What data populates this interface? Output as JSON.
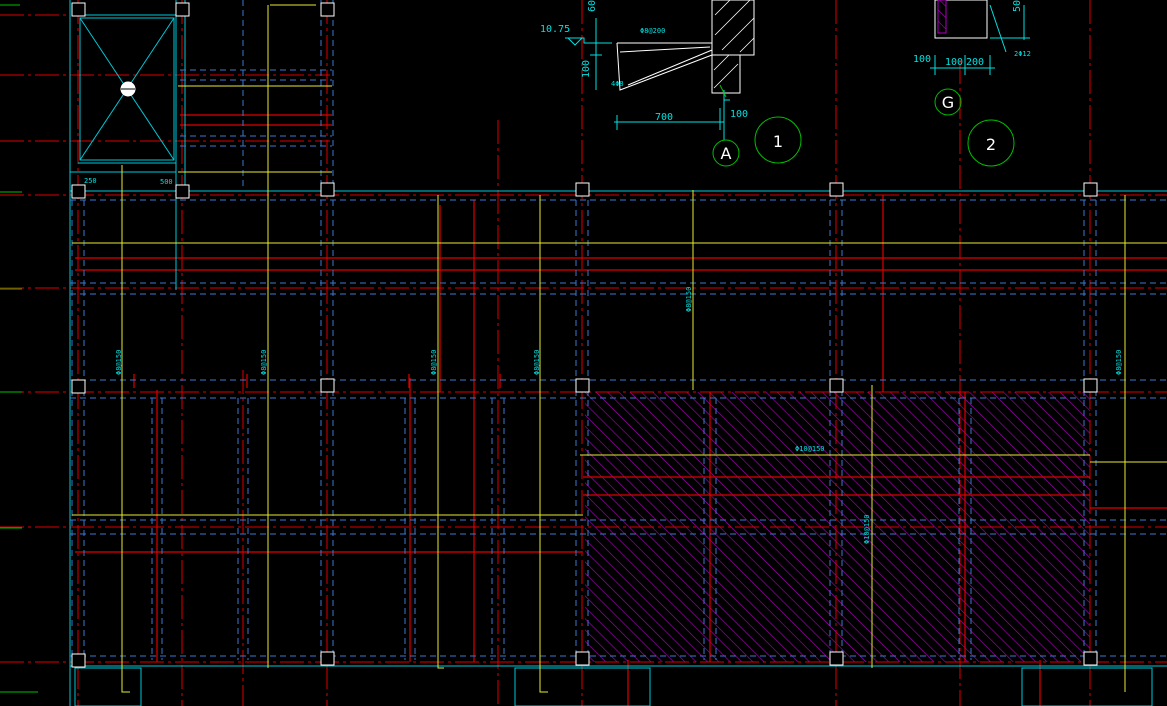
{
  "colors": {
    "background": "#000000",
    "axis_red": "#e00000",
    "beam_cyan": "#00c8d8",
    "beam_dash_blue": "#3a78d0",
    "rebar_yellow": "#e8e830",
    "label_cyan": "#00e0e0",
    "hatch_magenta": "#b000c0",
    "bubble_green": "#00c000",
    "column_white": "#ffffff"
  },
  "drawing": {
    "elevation_label": "10.75",
    "dims": {
      "d60": "60",
      "d100a": "100",
      "d100b": "100",
      "d700": "700",
      "d100c": "100",
      "d100d": "100",
      "d200": "200",
      "d50": "50",
      "d250": "250",
      "d500": "500"
    },
    "rebar_notes": {
      "top_section_a": "Φ8@200",
      "top_section_b": "4Φ8",
      "section_g": "2Φ12",
      "slab_1": "Φ8@150",
      "slab_2": "Φ8@150",
      "slab_3": "Φ8@150",
      "slab_4": "Φ8@150",
      "slab_5": "Φ8@150",
      "slab_6": "Φ8@150",
      "slab_7": "Φ10@150",
      "slab_8": "Φ10@150"
    },
    "bubbles": {
      "axis_a": "A",
      "axis_g": "G",
      "detail_1": "1",
      "detail_2": "2"
    }
  }
}
